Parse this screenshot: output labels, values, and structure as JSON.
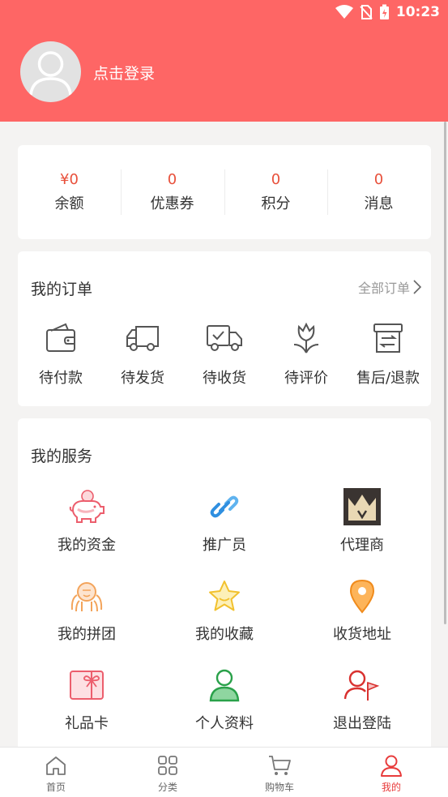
{
  "status_bar": {
    "time": "10:23",
    "icons": [
      "wifi-icon",
      "no-sim-icon",
      "battery-charging-icon"
    ]
  },
  "profile": {
    "login_text": "点击登录",
    "avatar_icon": "user-avatar-icon"
  },
  "stats": [
    {
      "value": "¥0",
      "label": "余额"
    },
    {
      "value": "0",
      "label": "优惠券"
    },
    {
      "value": "0",
      "label": "积分"
    },
    {
      "value": "0",
      "label": "消息"
    }
  ],
  "orders": {
    "title": "我的订单",
    "all_orders_label": "全部订单",
    "items": [
      {
        "label": "待付款",
        "icon": "wallet-icon"
      },
      {
        "label": "待发货",
        "icon": "truck-icon"
      },
      {
        "label": "待收货",
        "icon": "delivery-check-icon"
      },
      {
        "label": "待评价",
        "icon": "tulip-icon"
      },
      {
        "label": "售后/退款",
        "icon": "return-box-icon"
      }
    ]
  },
  "services": {
    "title": "我的服务",
    "items": [
      {
        "label": "我的资金",
        "icon": "piggy-bank-icon"
      },
      {
        "label": "推广员",
        "icon": "link-icon"
      },
      {
        "label": "代理商",
        "icon": "crown-icon"
      },
      {
        "label": "我的拼团",
        "icon": "group-icon"
      },
      {
        "label": "我的收藏",
        "icon": "star-icon"
      },
      {
        "label": "收货地址",
        "icon": "location-pin-icon"
      },
      {
        "label": "礼品卡",
        "icon": "gift-card-icon"
      },
      {
        "label": "个人资料",
        "icon": "person-icon"
      },
      {
        "label": "退出登陆",
        "icon": "logout-user-icon"
      }
    ]
  },
  "tabbar": {
    "items": [
      {
        "label": "首页",
        "icon": "home-icon",
        "active": false
      },
      {
        "label": "分类",
        "icon": "grid-icon",
        "active": false
      },
      {
        "label": "购物车",
        "icon": "cart-icon",
        "active": false
      },
      {
        "label": "我的",
        "icon": "user-icon",
        "active": true
      }
    ]
  },
  "colors": {
    "header": "#fe6665",
    "accent": "#e83c3c",
    "price": "#e8503b",
    "background": "#f4f3f2"
  }
}
